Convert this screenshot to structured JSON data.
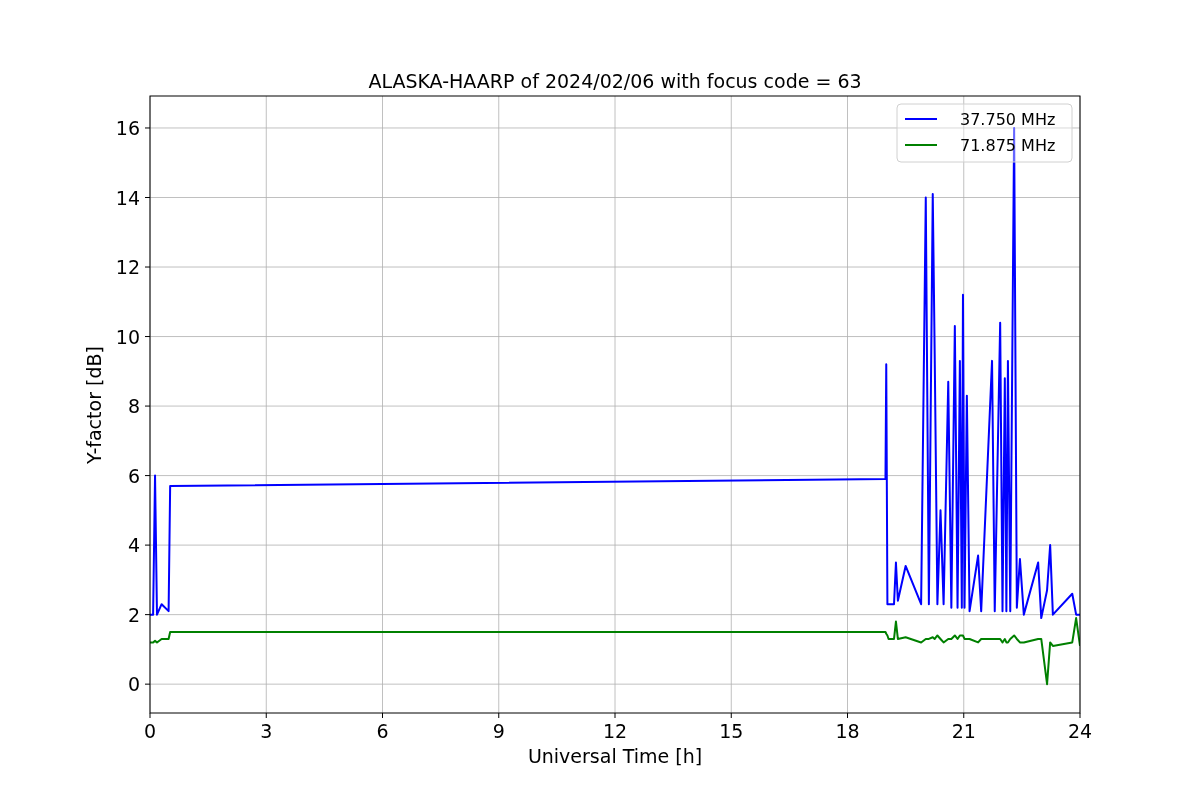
{
  "chart": {
    "chart_data": {
      "type": "line",
      "title": "ALASKA-HAARP of 2024/02/06 with focus code = 63",
      "xlabel": "Universal Time [h]",
      "ylabel": "Y-factor [dB]",
      "grid": true,
      "legend": true,
      "xlim": [
        0,
        24
      ],
      "ylim": [
        -0.83,
        16.92
      ],
      "xticks": [
        0,
        3,
        6,
        9,
        12,
        15,
        18,
        21,
        24
      ],
      "yticks": [
        0,
        2,
        4,
        6,
        8,
        10,
        12,
        14,
        16
      ],
      "x": [
        0,
        0.08,
        0.13,
        0.18,
        0.3,
        0.48,
        0.52,
        18.98,
        19.0,
        19.03,
        19.06,
        19.2,
        19.25,
        19.3,
        19.5,
        19.9,
        20.02,
        20.1,
        20.2,
        20.25,
        20.32,
        20.4,
        20.48,
        20.6,
        20.68,
        20.77,
        20.84,
        20.9,
        20.95,
        20.98,
        21.02,
        21.08,
        21.15,
        21.37,
        21.45,
        21.73,
        21.8,
        21.94,
        22.0,
        22.06,
        22.1,
        22.14,
        22.2,
        22.3,
        22.37,
        22.45,
        22.55,
        22.92,
        23.0,
        23.15,
        23.23,
        23.3,
        23.8,
        23.9,
        24
      ],
      "series": [
        {
          "name": "37.750 MHz",
          "color": "#0000ff",
          "values": [
            2.0,
            2.0,
            6.0,
            2.0,
            2.3,
            2.1,
            5.7,
            5.9,
            9.2,
            2.3,
            2.3,
            2.3,
            3.5,
            2.4,
            3.4,
            2.3,
            14.0,
            2.3,
            14.1,
            9.5,
            2.3,
            5.0,
            2.3,
            8.7,
            2.2,
            10.3,
            2.2,
            9.3,
            2.2,
            11.2,
            2.2,
            8.3,
            2.1,
            3.7,
            2.1,
            9.3,
            2.1,
            10.4,
            2.1,
            8.8,
            2.1,
            9.3,
            2.1,
            16.0,
            2.2,
            3.6,
            2.0,
            3.5,
            1.9,
            2.7,
            4.0,
            2.0,
            2.6,
            2.0,
            2.0
          ]
        },
        {
          "name": "71.875 MHz",
          "color": "#008000",
          "values": [
            1.2,
            1.2,
            1.25,
            1.2,
            1.3,
            1.3,
            1.5,
            1.5,
            1.45,
            1.4,
            1.3,
            1.3,
            1.8,
            1.3,
            1.35,
            1.2,
            1.3,
            1.3,
            1.35,
            1.3,
            1.4,
            1.3,
            1.2,
            1.3,
            1.3,
            1.4,
            1.3,
            1.4,
            1.4,
            1.4,
            1.3,
            1.3,
            1.3,
            1.2,
            1.3,
            1.3,
            1.3,
            1.3,
            1.2,
            1.3,
            1.2,
            1.2,
            1.3,
            1.4,
            1.3,
            1.2,
            1.2,
            1.3,
            1.3,
            0.0,
            1.2,
            1.1,
            1.2,
            1.9,
            1.1
          ]
        }
      ]
    }
  }
}
